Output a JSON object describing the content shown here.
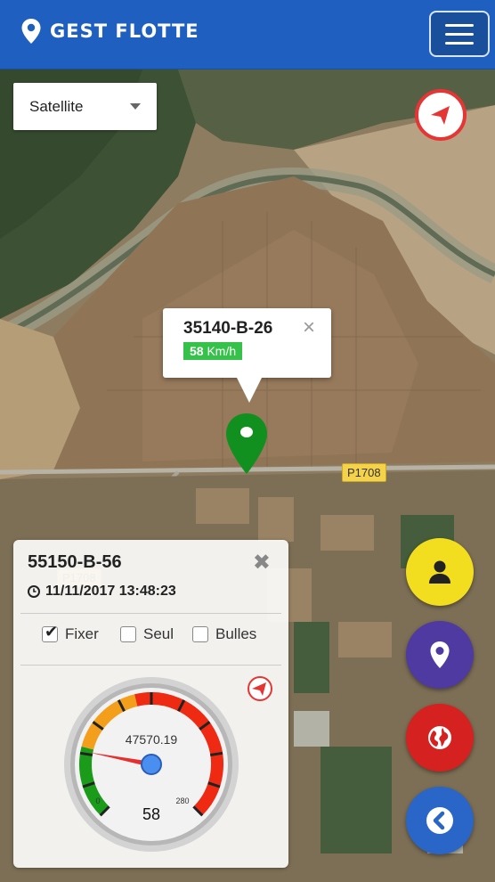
{
  "app": {
    "title": "GEST FLOTTE",
    "header_color": "#1f5fbf",
    "icons": {
      "logo": "map-pin-icon",
      "menu": "hamburger-icon"
    }
  },
  "map": {
    "type_select": {
      "value": "Satellite"
    },
    "road_label": "P1708",
    "popup": {
      "plate": "35140-B-26",
      "speed_value": "58",
      "speed_unit": "Km/h",
      "speed_color": "#36c24a"
    },
    "marker_color": "#119020"
  },
  "panel": {
    "plate": "55150-B-56",
    "datetime": "11/11/2017 13:48:23",
    "options": [
      {
        "label": "Fixer",
        "checked": true
      },
      {
        "label": "Seul",
        "checked": false
      },
      {
        "label": "Bulles",
        "checked": false
      }
    ],
    "gauge": {
      "odometer": "47570.19",
      "speed": "58",
      "min_label": "0",
      "max_label": "280",
      "value": 58,
      "max": 280
    }
  },
  "fabs": [
    {
      "icon": "user-icon",
      "color": "#f2de1f"
    },
    {
      "icon": "location-icon",
      "color": "#4e3aa0"
    },
    {
      "icon": "globe-icon",
      "color": "#d62121"
    },
    {
      "icon": "back-arrow-icon",
      "color": "#2966c8"
    }
  ]
}
